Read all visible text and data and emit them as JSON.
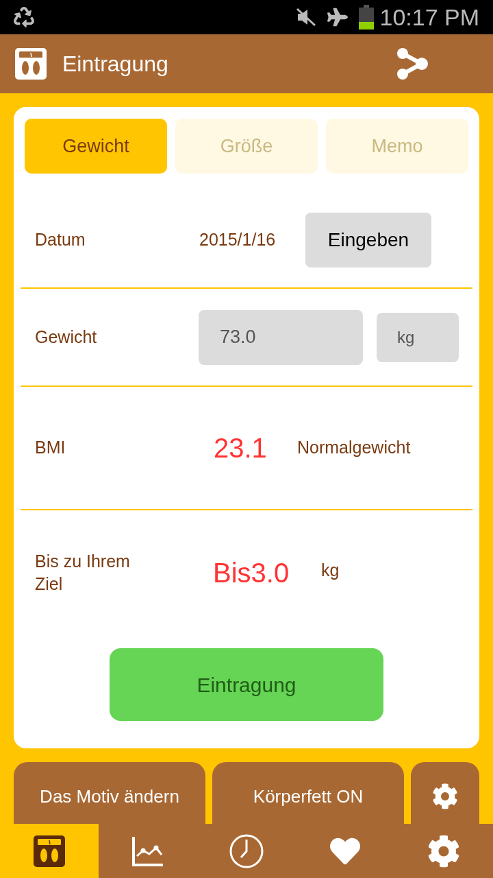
{
  "status_bar": {
    "time": "10:17 PM"
  },
  "app_bar": {
    "title": "Eintragung"
  },
  "tabs": [
    {
      "label": "Gewicht",
      "selected": true
    },
    {
      "label": "Größe",
      "selected": false
    },
    {
      "label": "Memo",
      "selected": false
    }
  ],
  "date_row": {
    "label": "Datum",
    "value": "2015/1/16",
    "button": "Eingeben"
  },
  "weight_row": {
    "label": "Gewicht",
    "value": "73.0",
    "unit": "kg"
  },
  "bmi_row": {
    "label": "BMI",
    "value": "23.1",
    "category": "Normalgewicht"
  },
  "goal_row": {
    "label": "Bis zu Ihrem Ziel",
    "value": "Bis3.0",
    "unit": "kg"
  },
  "submit_button": "Eintragung",
  "action_buttons": [
    "Das Motiv ändern",
    "Körperfett ON"
  ],
  "bottom_nav": [
    {
      "kind": "scale",
      "selected": true
    },
    {
      "kind": "chart",
      "selected": false
    },
    {
      "kind": "clock",
      "selected": false
    },
    {
      "kind": "heart",
      "selected": false
    },
    {
      "kind": "gear",
      "selected": false
    }
  ]
}
